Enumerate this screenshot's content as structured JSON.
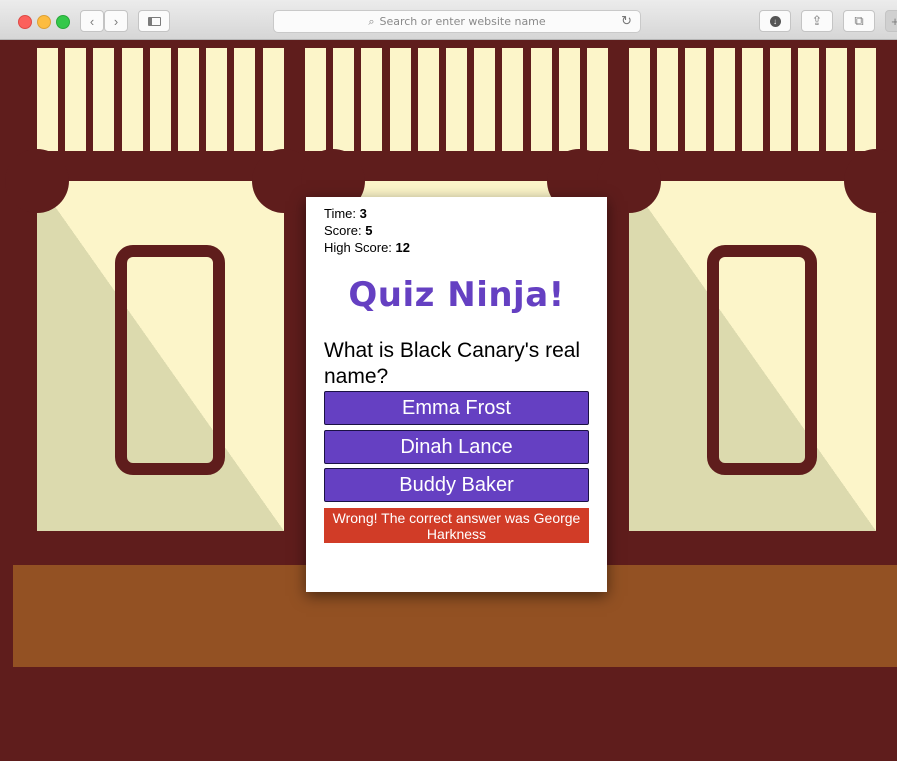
{
  "browser": {
    "address_placeholder": "Search or enter website name",
    "icons": [
      "back-arrow-icon",
      "forward-arrow-icon",
      "sidebar-icon",
      "search-icon",
      "reload-icon",
      "download-icon",
      "share-icon",
      "tabs-icon",
      "new-tab-icon"
    ]
  },
  "stats": {
    "time_label": "Time:",
    "time_value": "3",
    "score_label": "Score:",
    "score_value": "5",
    "high_score_label": "High Score:",
    "high_score_value": "12"
  },
  "title": "Quiz Ninja!",
  "question": "What is Black Canary's real name?",
  "answers": [
    "Emma Frost",
    "Dinah Lance",
    "Buddy Baker"
  ],
  "feedback": "Wrong! The correct answer was George Harkness",
  "colors": {
    "background": "#5f1d1c",
    "cream": "#fcf5c9",
    "panel_shade": "#dcdaae",
    "counter": "#935123",
    "accent_purple": "#6540c2",
    "wrong_red": "#d13c27"
  }
}
